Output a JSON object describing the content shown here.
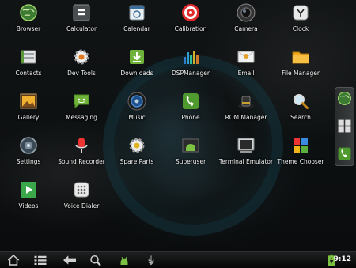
{
  "apps": [
    {
      "label": "Browser",
      "icon": "globe-icon"
    },
    {
      "label": "Calculator",
      "icon": "calculator-icon"
    },
    {
      "label": "Calendar",
      "icon": "calendar-icon"
    },
    {
      "label": "Calibration",
      "icon": "target-icon"
    },
    {
      "label": "Camera",
      "icon": "camera-icon"
    },
    {
      "label": "Clock",
      "icon": "clock-icon"
    },
    {
      "label": "Contacts",
      "icon": "contacts-icon"
    },
    {
      "label": "Dev Tools",
      "icon": "gear-icon"
    },
    {
      "label": "Downloads",
      "icon": "download-icon"
    },
    {
      "label": "DSPManager",
      "icon": "equalizer-icon"
    },
    {
      "label": "Email",
      "icon": "envelope-icon"
    },
    {
      "label": "File Manager",
      "icon": "folder-icon"
    },
    {
      "label": "Gallery",
      "icon": "picture-icon"
    },
    {
      "label": "Messaging",
      "icon": "chat-bubble-icon"
    },
    {
      "label": "Music",
      "icon": "speaker-icon"
    },
    {
      "label": "Phone",
      "icon": "phone-icon"
    },
    {
      "label": "ROM Manager",
      "icon": "hat-icon"
    },
    {
      "label": "Search",
      "icon": "magnifier-icon"
    },
    {
      "label": "Settings",
      "icon": "settings-knob-icon"
    },
    {
      "label": "Sound Recorder",
      "icon": "microphone-icon"
    },
    {
      "label": "Spare Parts",
      "icon": "gear-icon"
    },
    {
      "label": "Superuser",
      "icon": "android-icon"
    },
    {
      "label": "Terminal Emulator",
      "icon": "terminal-icon"
    },
    {
      "label": "Theme Chooser",
      "icon": "puzzle-icon"
    },
    {
      "label": "Videos",
      "icon": "play-icon"
    },
    {
      "label": "Voice Dialer",
      "icon": "keypad-icon"
    }
  ],
  "side_dock": [
    "browser-icon",
    "all-apps-grid-icon",
    "phone-icon"
  ],
  "nav_bar": [
    "home-icon",
    "menu-list-icon",
    "back-arrow-icon",
    "search-icon",
    "notification-android-icon",
    "usb-icon"
  ],
  "status": {
    "time": "9:12",
    "battery": "battery-charging-icon"
  },
  "colors": {
    "label_text": "#f2f2f2",
    "bar_bg": "#0f0f0f",
    "accent_green": "#7cc142"
  }
}
